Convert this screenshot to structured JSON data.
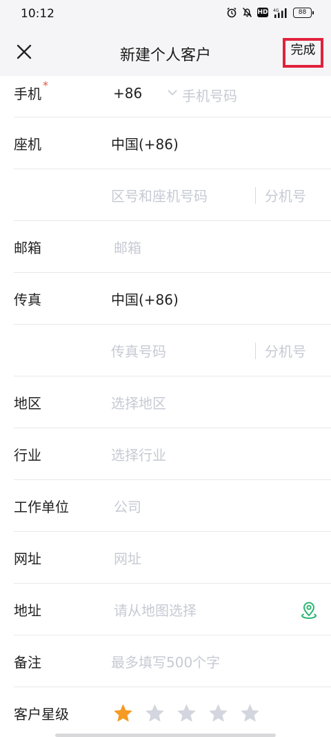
{
  "status": {
    "time": "10:12",
    "hd": "HD",
    "battery": "88"
  },
  "header": {
    "title": "新建个人客户",
    "done_label": "完成"
  },
  "form": {
    "mobile": {
      "label": "手机",
      "required_mark": "*",
      "country_code": "+86",
      "placeholder": "手机号码"
    },
    "landline": {
      "label": "座机",
      "country": "中国(+86)",
      "number_placeholder": "区号和座机号码",
      "ext_placeholder": "分机号"
    },
    "email": {
      "label": "邮箱",
      "placeholder": "邮箱"
    },
    "fax": {
      "label": "传真",
      "country": "中国(+86)",
      "number_placeholder": "传真号码",
      "ext_placeholder": "分机号"
    },
    "region": {
      "label": "地区",
      "placeholder": "选择地区"
    },
    "industry": {
      "label": "行业",
      "placeholder": "选择行业"
    },
    "company": {
      "label": "工作单位",
      "placeholder": "公司"
    },
    "website": {
      "label": "网址",
      "placeholder": "网址"
    },
    "address": {
      "label": "地址",
      "placeholder": "请从地图选择",
      "icon": "map-pin-icon"
    },
    "remark": {
      "label": "备注",
      "placeholder": "最多填写500个字"
    },
    "rating": {
      "label": "客户星级",
      "value": 1,
      "max": 5,
      "active_color": "#f59a23",
      "inactive_color": "#d3d6de"
    }
  },
  "colors": {
    "accent_red": "#e2213c",
    "placeholder": "#c6cad3",
    "location_green": "#2bb673"
  }
}
